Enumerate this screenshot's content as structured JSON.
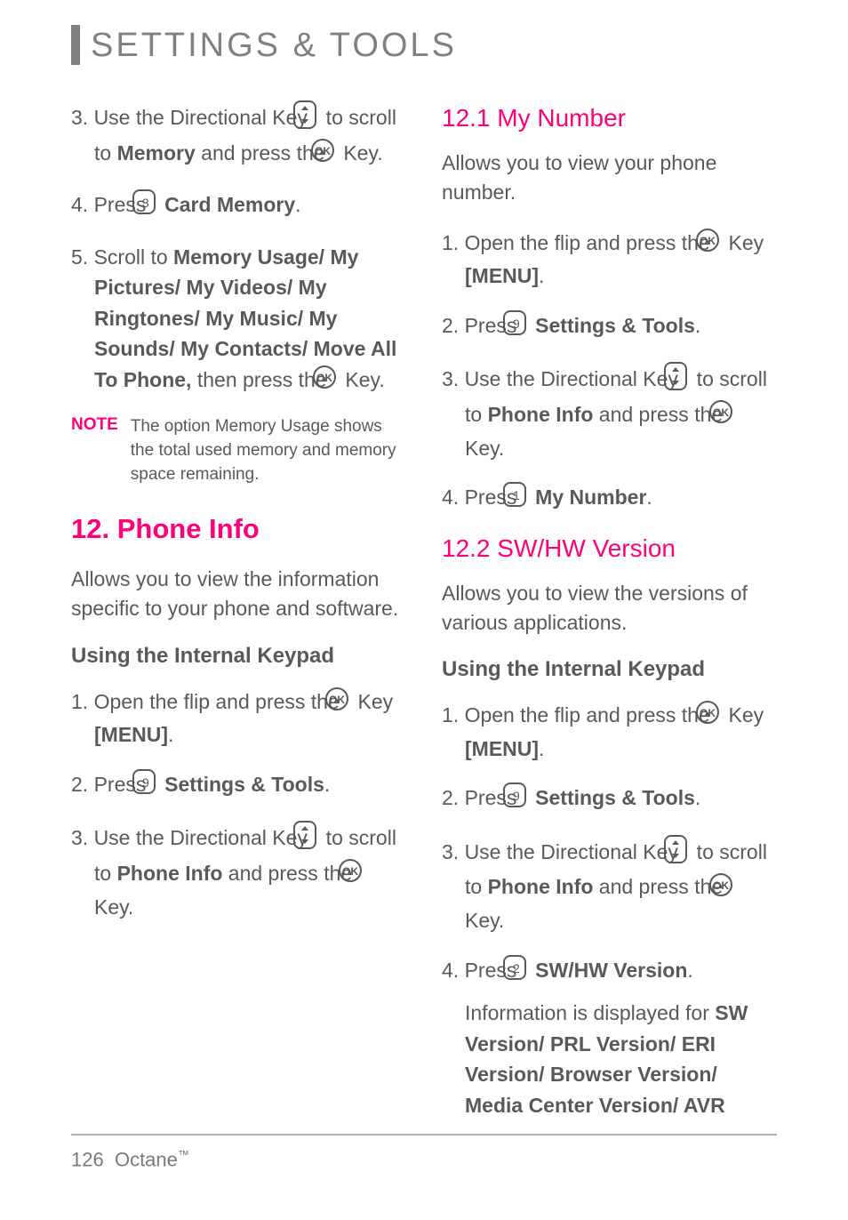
{
  "header": {
    "title": "SETTINGS & TOOLS"
  },
  "left": {
    "step3_a": "3. Use the Directional Key ",
    "step3_b": " to scroll to ",
    "step3_bold": "Memory",
    "step3_c": " and press the ",
    "step3_d": " Key.",
    "step4_a": "4. Press ",
    "step4_bold": "Card Memory",
    "step4_c": ".",
    "step5_a": "5. Scroll to ",
    "step5_bold": "Memory Usage/ My Pictures/ My Videos/ My Ringtones/ My Music/ My Sounds/ My Contacts/ Move All To Phone,",
    "step5_c": " then press the ",
    "step5_d": " Key.",
    "note_label": "NOTE",
    "note_body": "The option Memory Usage shows the total used memory and memory space remaining.",
    "h1": "12. Phone Info",
    "para1": "Allows you to view the information specific to your phone and software.",
    "sub1": "Using the Internal Keypad",
    "pi_step1_a": "1. Open the flip and press the ",
    "pi_step1_b": " Key ",
    "pi_step1_bold": "[MENU]",
    "pi_step1_c": ".",
    "pi_step2_a": "2. Press ",
    "pi_step2_bold": "Settings & Tools",
    "pi_step2_c": ".",
    "pi_step3_a": "3. Use the Directional Key ",
    "pi_step3_b": " to scroll to ",
    "pi_step3_bold": "Phone Info",
    "pi_step3_c": " and press the ",
    "pi_step3_d": " Key."
  },
  "right": {
    "h2a": "12.1 My Number",
    "para_a": "Allows you to view your phone number.",
    "a1_a": "1. Open the flip and press the ",
    "a1_b": " Key ",
    "a1_bold": "[MENU]",
    "a1_c": ".",
    "a2_a": "2. Press ",
    "a2_bold": "Settings & Tools",
    "a2_c": ".",
    "a3_a": "3. Use the Directional Key ",
    "a3_b": " to scroll to ",
    "a3_bold": "Phone Info",
    "a3_c": " and press the ",
    "a3_d": " Key.",
    "a4_a": "4. Press ",
    "a4_bold": "My Number",
    "a4_c": ".",
    "h2b": "12.2 SW/HW Version",
    "para_b": "Allows you to view the versions of various applications.",
    "sub_b": "Using the Internal Keypad",
    "b1_a": "1. Open the flip and press the ",
    "b1_b": " Key ",
    "b1_bold": "[MENU]",
    "b1_c": ".",
    "b2_a": "2. Press ",
    "b2_bold": "Settings & Tools",
    "b2_c": ".",
    "b3_a": "3. Use the Directional Key ",
    "b3_b": " to scroll to ",
    "b3_bold": "Phone Info",
    "b3_c": " and press the ",
    "b3_d": " Key.",
    "b4_a": "4. Press ",
    "b4_bold": "SW/HW Version",
    "b4_c": ".",
    "b4_info_a": "Information is displayed for ",
    "b4_info_bold": "SW Version/ PRL Version/ ERI Version/ Browser Version/ Media Center Version/ AVR"
  },
  "footer": {
    "page": "126",
    "model": "Octane",
    "tm": "™"
  }
}
